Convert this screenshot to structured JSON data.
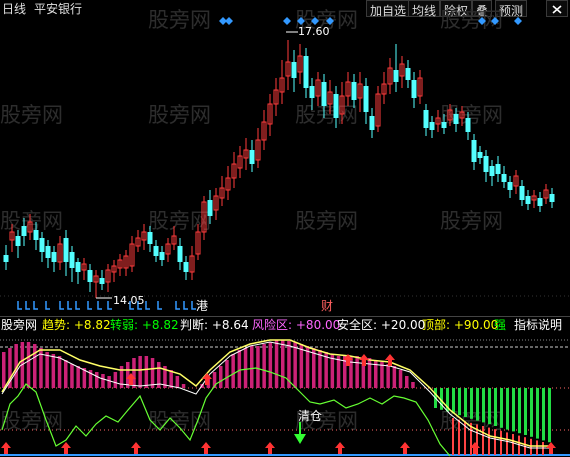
{
  "header": {
    "period": "日线",
    "stock_name": "平安银行"
  },
  "toolbar": {
    "buttons": [
      "加自选",
      "均线",
      "除权",
      "叠",
      "预测"
    ],
    "close_icon": "close-icon"
  },
  "price_chart": {
    "high_label": "17.60",
    "low_label": "14.05",
    "event_labels": {
      "gang": "港",
      "cai": "财"
    }
  },
  "indicator_bar": {
    "site": "股旁网",
    "items": [
      {
        "label": "趋势",
        "value": "+8.82",
        "color": "#ffff00"
      },
      {
        "label": "转弱",
        "value": "+8.82",
        "color": "#00ff00"
      },
      {
        "label": "判断",
        "value": "+8.64",
        "color": "#ffffff"
      },
      {
        "label": "风险区",
        "value": "+80.00",
        "color": "#ff55ff"
      },
      {
        "label": "安全区",
        "value": "+20.00",
        "color": "#ffffff"
      },
      {
        "label": "顶部",
        "value": "+90.00",
        "color": "#ffff00"
      },
      {
        "label": "强",
        "value": "",
        "color": "#00ff00"
      }
    ],
    "help_link": "指标说明"
  },
  "indicator_chart": {
    "signal_label": "清仓"
  },
  "watermark": "股旁网",
  "colors": {
    "up_candle": "#ff3c3c",
    "down_candle": "#54ffff",
    "magenta_hist": "#cc2277",
    "green_hist": "#22dd44",
    "yellow_line": "#ffff66"
  }
}
